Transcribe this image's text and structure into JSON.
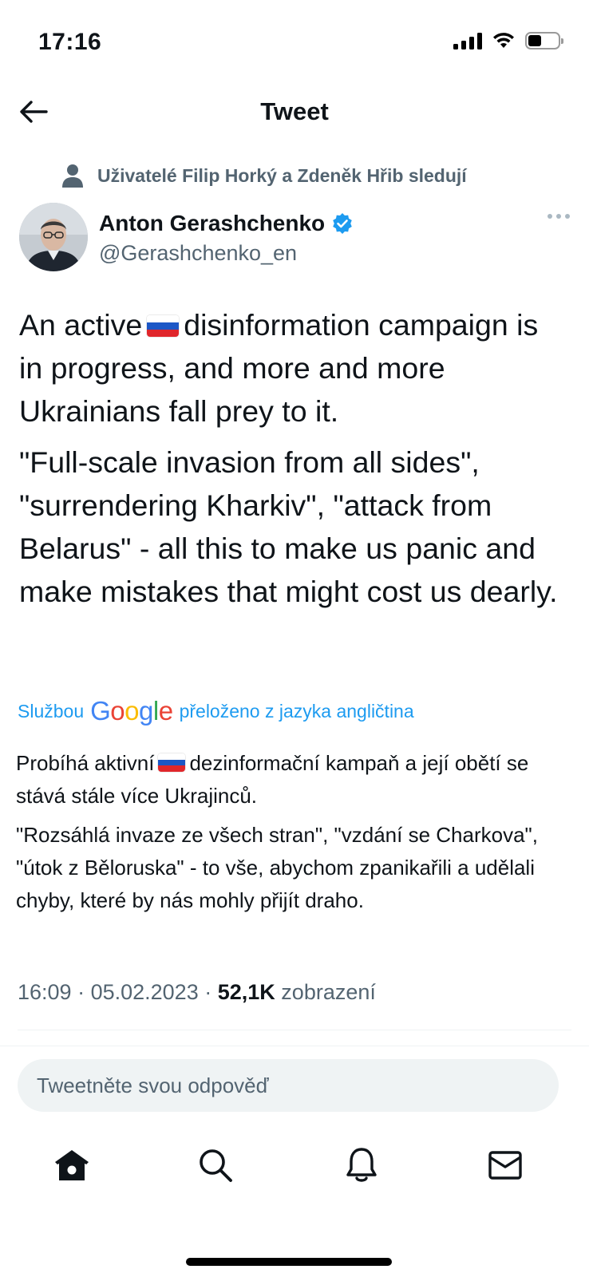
{
  "status_bar": {
    "time": "17:16"
  },
  "header": {
    "title": "Tweet"
  },
  "social_context": {
    "text": "Uživatelé Filip Horký a Zdeněk Hřib sledují"
  },
  "author": {
    "name": "Anton Gerashchenko",
    "handle": "@Gerashchenko_en",
    "verified": true
  },
  "tweet": {
    "p1_before_flag": "An active",
    "p1_after_flag": "disinformation campaign is in progress, and more and more Ukrainians fall prey to it.",
    "p2": "\"Full-scale invasion from all sides\", \"surrendering Kharkiv\", \"attack from Belarus\" - all this to make us panic and make mistakes that might cost us dearly."
  },
  "translation": {
    "prefix": "Službou",
    "google": "Google",
    "suffix": "přeloženo z jazyka angličtina",
    "p1_before_flag": "Probíhá aktivní",
    "p1_after_flag": "dezinformační kampaň a její obětí se stává stále více Ukrajinců.",
    "p2": "\"Rozsáhlá invaze ze všech stran\", \"vzdání se Charkova\", \"útok z Běloruska\" - to vše, abychom zpanikařili a udělali chyby, které by nás mohly přijít draho."
  },
  "meta": {
    "time": "16:09",
    "date": "05.02.2023",
    "views_count": "52,1K",
    "views_label": "zobrazení"
  },
  "reply": {
    "placeholder": "Tweetněte svou odpověď"
  },
  "nav": {
    "items": [
      "home-icon",
      "search-icon",
      "notifications-icon",
      "messages-icon"
    ]
  },
  "colors": {
    "accent": "#1d9bf0",
    "secondary_text": "#536471"
  }
}
